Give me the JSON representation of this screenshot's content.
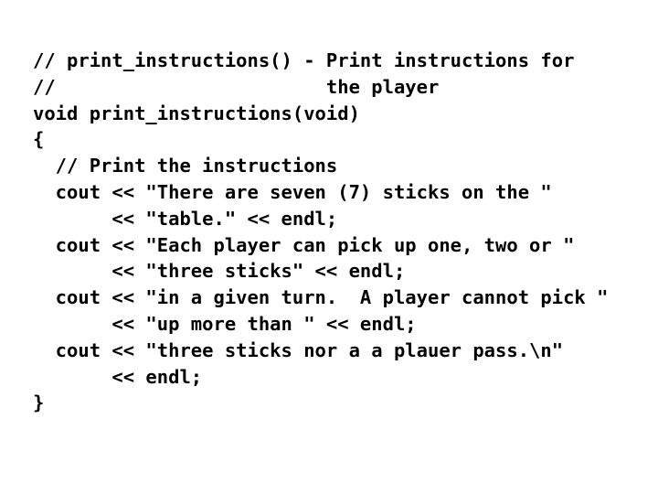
{
  "slide": {
    "background_color": "#ffffff",
    "text_color": "#000000",
    "language": "cpp",
    "title": "print_instructions"
  },
  "code": {
    "lines": [
      "// print_instructions() - Print instructions for",
      "//                        the player",
      "void print_instructions(void)",
      "{",
      "  // Print the instructions",
      "  cout << \"There are seven (7) sticks on the \"",
      "       << \"table.\" << endl;",
      "  cout << \"Each player can pick up one, two or \"",
      "       << \"three sticks\" << endl;",
      "  cout << \"in a given turn.  A player cannot pick \"",
      "       << \"up more than \" << endl;",
      "  cout << \"three sticks nor a a plauer pass.\\n\"",
      "       << endl;",
      "}"
    ]
  }
}
